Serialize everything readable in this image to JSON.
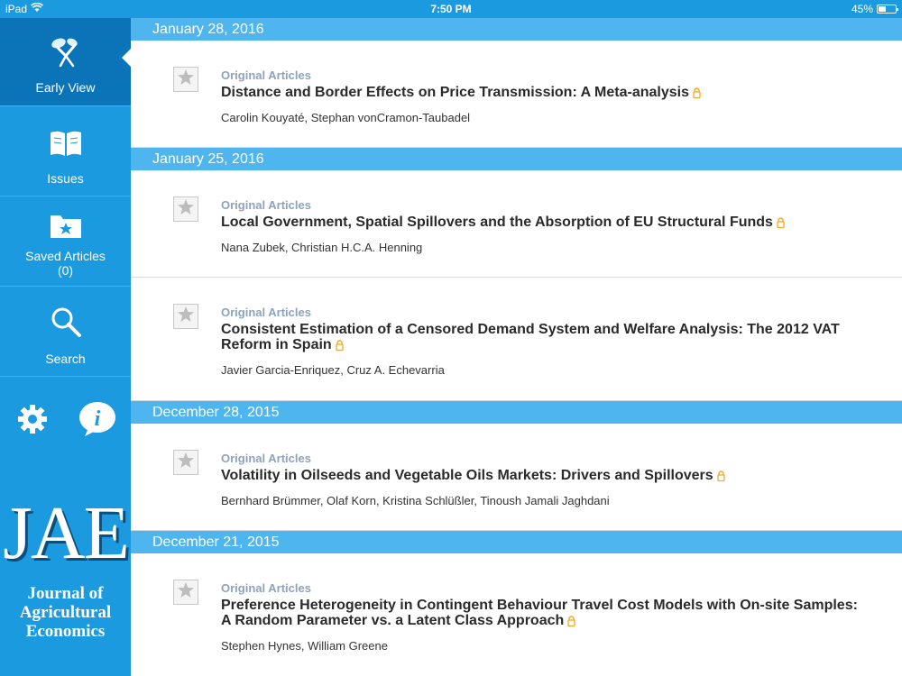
{
  "status_bar": {
    "device": "iPad",
    "time": "7:50 PM",
    "battery": "45%",
    "battery_level": 0.45
  },
  "sidebar": {
    "items": [
      {
        "label": "Early View",
        "icon": "early-view-icon",
        "active": true
      },
      {
        "label": "Issues",
        "icon": "book-icon"
      },
      {
        "label": "Saved Articles",
        "count": "(0)",
        "icon": "saved-folder-icon"
      },
      {
        "label": "Search",
        "icon": "search-icon"
      }
    ],
    "utility_icons": [
      "gear-icon",
      "info-icon"
    ],
    "logo": {
      "initials": "JAE",
      "line1": "Journal of",
      "line2": "Agricultural",
      "line3": "Economics"
    }
  },
  "feed": [
    {
      "date": "January 28, 2016",
      "articles": [
        {
          "section": "Original Articles",
          "title": "Distance and Border Effects on Price Transmission: A Meta-analysis",
          "authors": "Carolin Kouyaté, Stephan vonCramon-Taubadel"
        }
      ]
    },
    {
      "date": "January 25, 2016",
      "articles": [
        {
          "section": "Original Articles",
          "title": "Local Government, Spatial Spillovers and the Absorption of EU Structural Funds",
          "authors": "Nana Zubek, Christian H.C.A. Henning"
        },
        {
          "section": "Original Articles",
          "title": "Consistent Estimation of a Censored Demand System and Welfare Analysis: The 2012 VAT Reform in Spain",
          "authors": "Javier Garcia-Enriquez, Cruz A. Echevarria"
        }
      ]
    },
    {
      "date": "December 28, 2015",
      "articles": [
        {
          "section": "Original Articles",
          "title": "Volatility in Oilseeds and Vegetable Oils Markets: Drivers and Spillovers",
          "authors": "Bernhard Brümmer, Olaf Korn, Kristina Schlüßler, Tinoush Jamali Jaghdani"
        }
      ]
    },
    {
      "date": "December 21, 2015",
      "articles": [
        {
          "section": "Original Articles",
          "title": "Preference Heterogeneity in Contingent Behaviour Travel Cost Models with On-site Samples: A Random Parameter vs. a Latent Class Approach",
          "authors": "Stephen Hynes, William Greene"
        }
      ]
    }
  ],
  "colors": {
    "sidebar": "#1b9ae0",
    "sidebar_active": "#0b74b8",
    "date_header": "#4fb5ee",
    "section_label": "#8da3bd",
    "lock": "#f5a623"
  }
}
